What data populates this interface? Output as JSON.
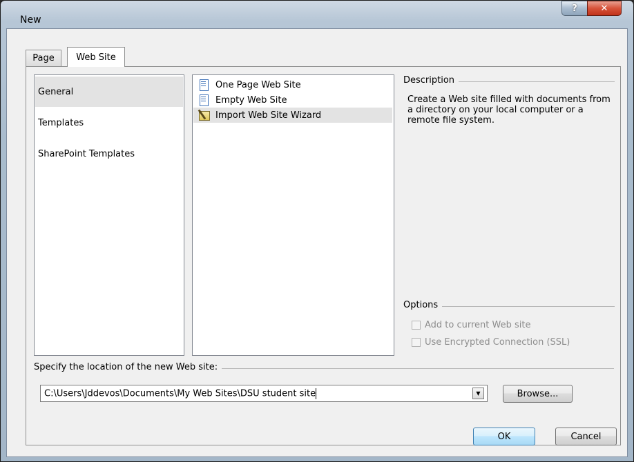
{
  "window": {
    "title": "New",
    "help_glyph": "?",
    "close_glyph": "✕"
  },
  "tabs": [
    {
      "label": "Page",
      "selected": false
    },
    {
      "label": "Web Site",
      "selected": true
    }
  ],
  "categories": [
    {
      "label": "General",
      "selected": true
    },
    {
      "label": "Templates",
      "selected": false
    },
    {
      "label": "SharePoint Templates",
      "selected": false
    }
  ],
  "templates": [
    {
      "label": "One Page Web Site",
      "icon": "page-icon",
      "selected": false
    },
    {
      "label": "Empty Web Site",
      "icon": "page-icon",
      "selected": false
    },
    {
      "label": "Import Web Site Wizard",
      "icon": "wizard-icon",
      "selected": true
    }
  ],
  "description": {
    "heading": "Description",
    "text": "Create a Web site filled with documents from a directory on your local computer or a remote file system."
  },
  "options": {
    "heading": "Options",
    "add_to_current": {
      "label": "Add to current Web site",
      "checked": false,
      "enabled": false
    },
    "use_ssl": {
      "label": "Use Encrypted Connection (SSL)",
      "checked": false,
      "enabled": false
    }
  },
  "location": {
    "label": "Specify the location of the new Web site:",
    "value": "C:\\Users\\Jddevos\\Documents\\My Web Sites\\DSU student site",
    "dropdown_glyph": "▼"
  },
  "buttons": {
    "browse": "Browse...",
    "ok": "OK",
    "cancel": "Cancel"
  }
}
